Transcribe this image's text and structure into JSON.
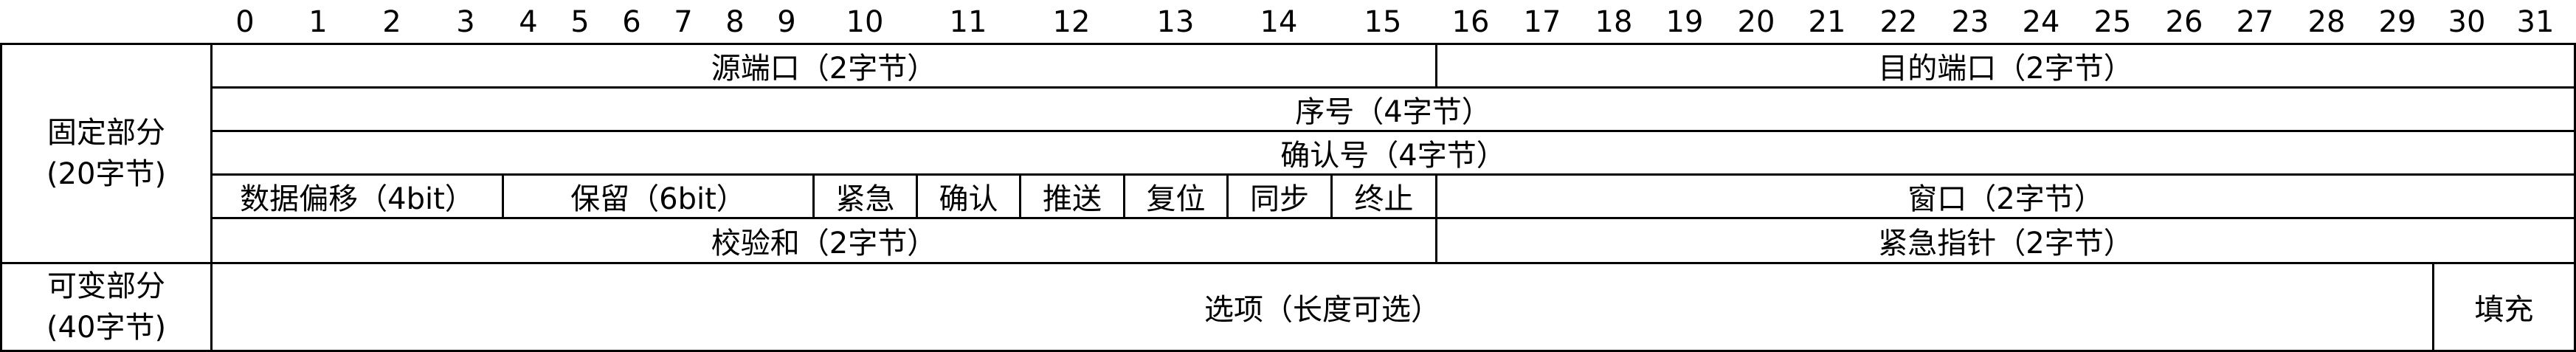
{
  "bit_numbers": [
    "0",
    "1",
    "2",
    "3",
    "4",
    "5",
    "6",
    "7",
    "8",
    "9",
    "10",
    "11",
    "12",
    "13",
    "14",
    "15",
    "16",
    "17",
    "18",
    "19",
    "20",
    "21",
    "22",
    "23",
    "24",
    "25",
    "26",
    "27",
    "28",
    "29",
    "30",
    "31"
  ],
  "fixed_part": {
    "line1": "固定部分",
    "line2": "(20字节)"
  },
  "variable_part": {
    "line1": "可变部分",
    "line2": "(40字节)"
  },
  "fields": {
    "source_port": "源端口（2字节）",
    "dest_port": "目的端口（2字节）",
    "seq": "序号（4字节）",
    "ack_num": "确认号（4字节）",
    "data_offset": "数据偏移（4bit）",
    "reserved": "保留（6bit）",
    "urg": "紧急",
    "ack": "确认",
    "psh": "推送",
    "rst": "复位",
    "syn": "同步",
    "fin": "终止",
    "window": "窗口（2字节）",
    "checksum": "校验和（2字节）",
    "urgent_ptr": "紧急指针（2字节）",
    "options": "选项（长度可选）",
    "padding": "填充"
  }
}
